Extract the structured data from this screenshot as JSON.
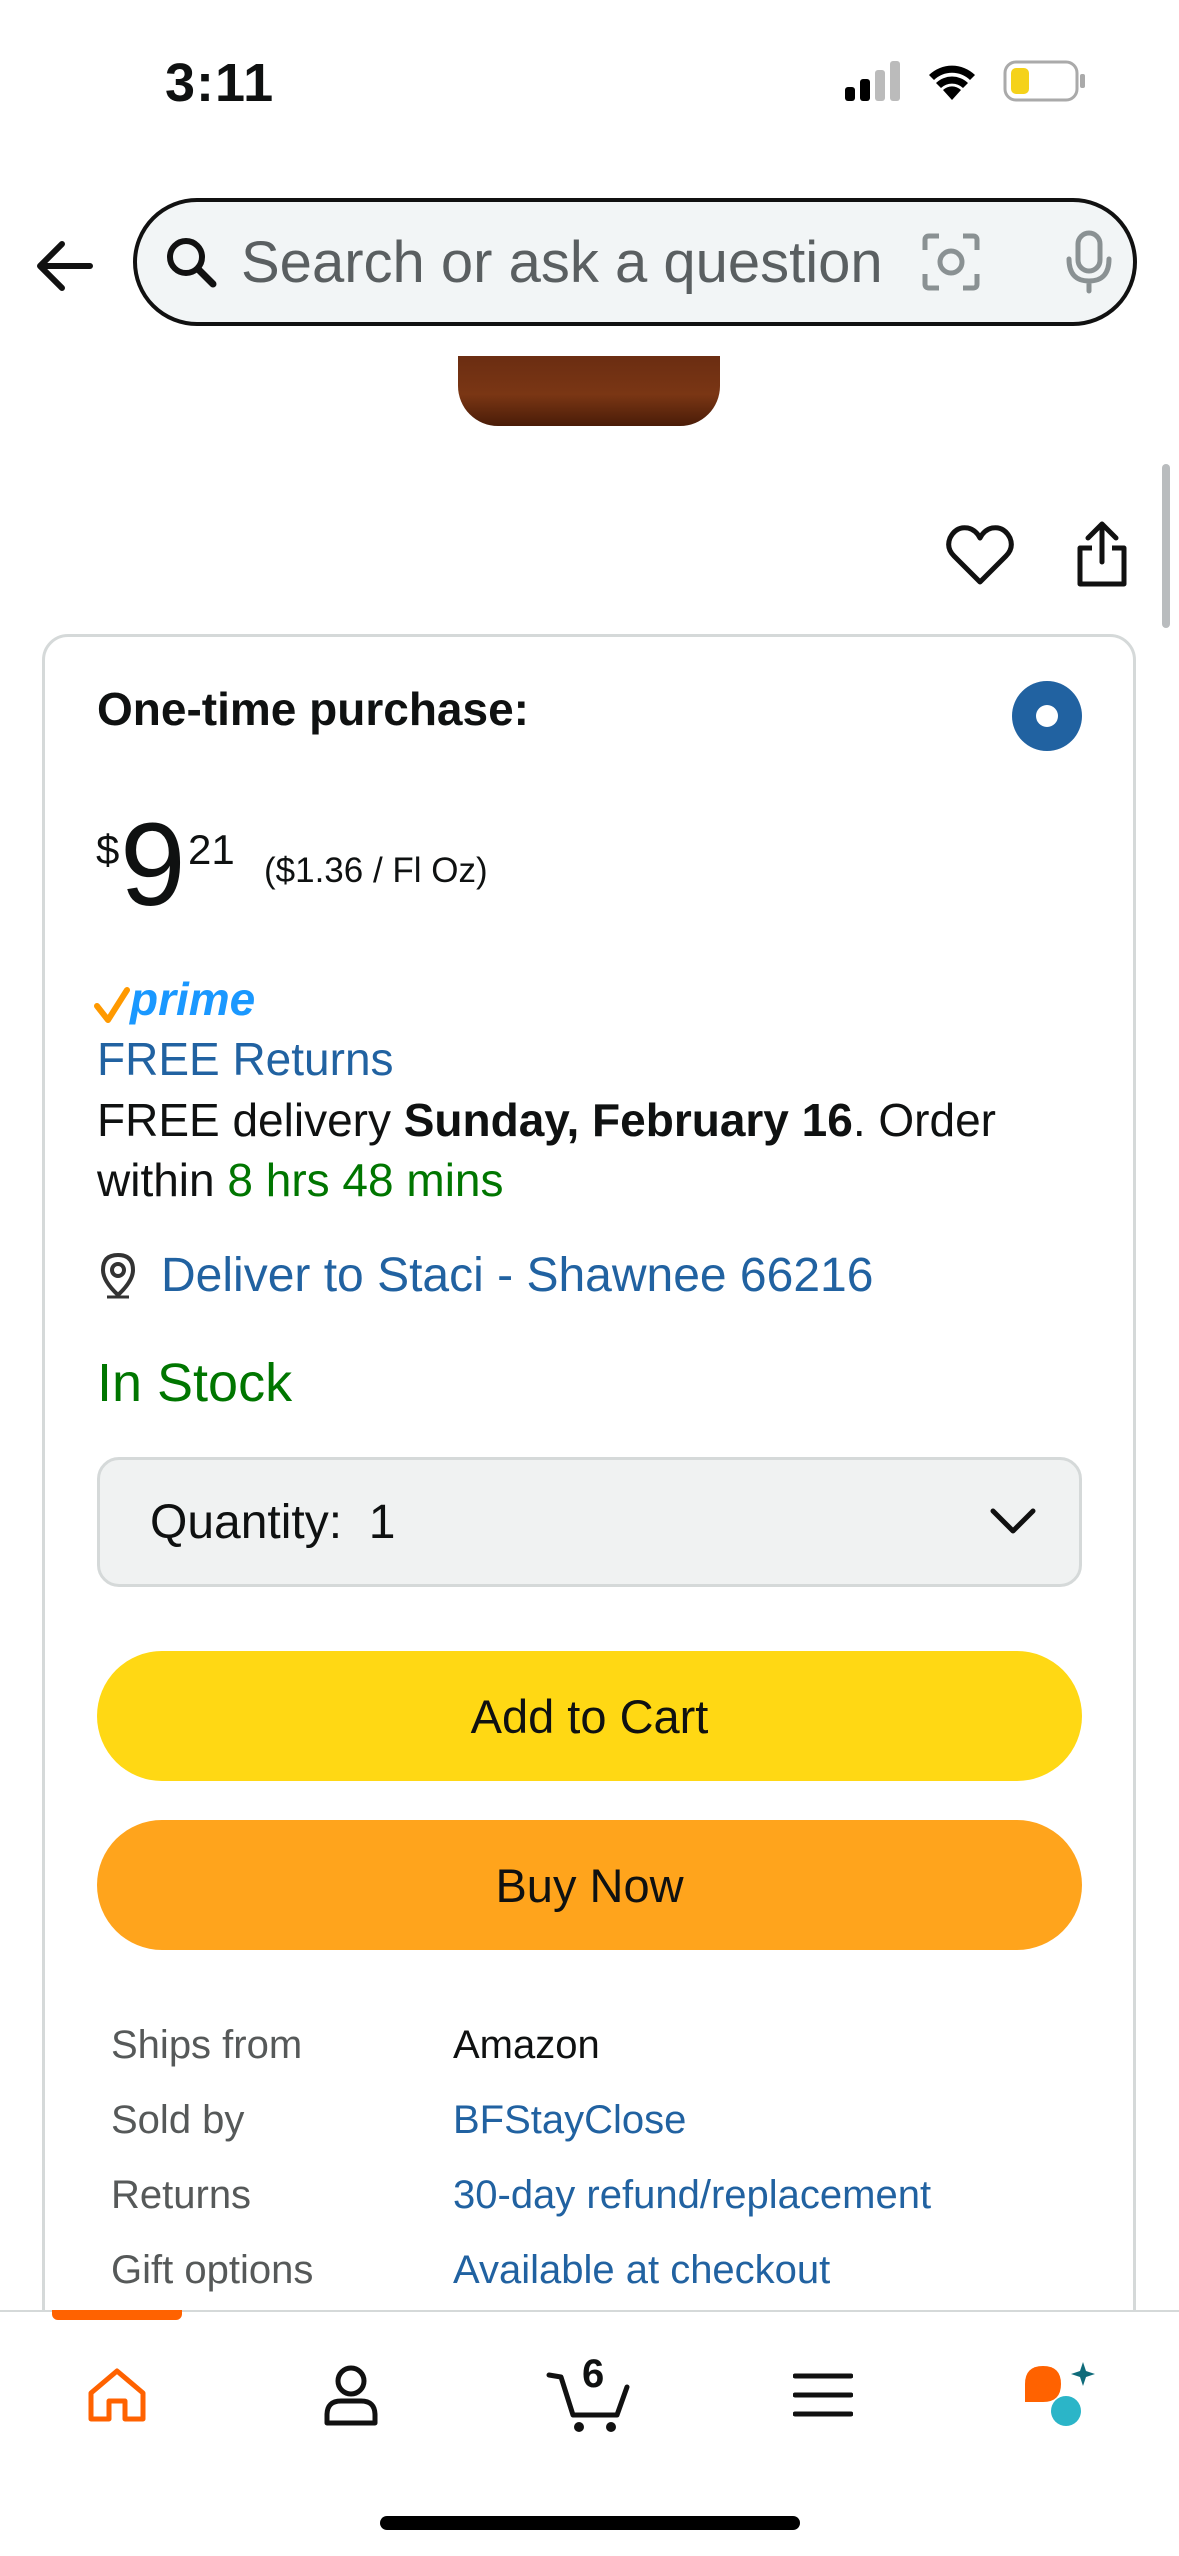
{
  "status_bar": {
    "time": "3:11"
  },
  "header": {
    "search_placeholder": "Search or ask a question"
  },
  "buybox": {
    "purchase_option_label": "One-time purchase:",
    "price": {
      "symbol": "$",
      "whole": "9",
      "fraction": "21",
      "unit_price": "($1.36 / Fl Oz)"
    },
    "prime_label": "prime",
    "free_returns": "FREE Returns",
    "delivery": {
      "prefix": "FREE delivery ",
      "date": "Sunday, February 16",
      "middle": ". Order within ",
      "countdown": "8 hrs 48 mins"
    },
    "deliver_to": "Deliver to Staci - Shawnee 66216",
    "stock_status": "In Stock",
    "quantity": {
      "label": "Quantity:",
      "value": "1"
    },
    "add_to_cart_label": "Add to Cart",
    "buy_now_label": "Buy Now",
    "info_rows": [
      {
        "key": "Ships from",
        "value": "Amazon"
      },
      {
        "key": "Sold by",
        "value": "BFStayClose"
      },
      {
        "key": "Returns",
        "value": "30-day refund/replacement"
      },
      {
        "key": "Gift options",
        "value": "Available at checkout"
      }
    ]
  },
  "bottom_nav": {
    "cart_count": "6",
    "active_tab": "home"
  },
  "colors": {
    "link": "#2162a1",
    "green": "#007600",
    "add_to_cart": "#ffd814",
    "buy_now": "#ffa41c",
    "nav_active": "#ff6200",
    "prime_blue": "#1a98ff",
    "prime_check": "#ff9900"
  },
  "icons": {
    "back": "arrow-left-icon",
    "search": "search-icon",
    "camera": "camera-lens-icon",
    "mic": "microphone-icon",
    "wishlist": "heart-icon",
    "share": "share-icon",
    "location": "location-pin-icon",
    "dropdown": "chevron-down-icon",
    "nav": [
      "home-icon",
      "account-icon",
      "cart-icon",
      "menu-icon",
      "rufus-assistant-icon"
    ]
  }
}
